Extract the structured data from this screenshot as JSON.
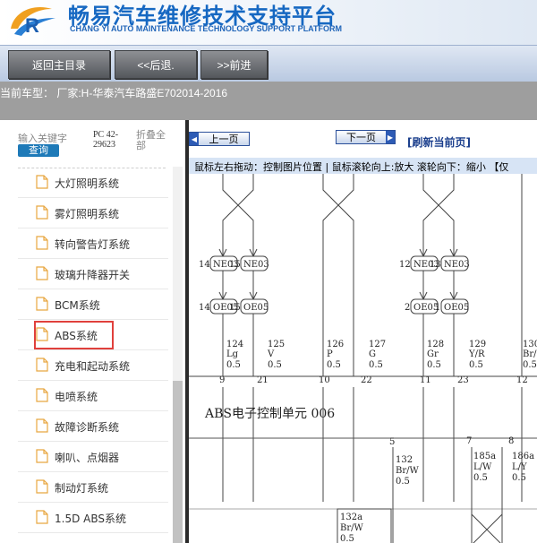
{
  "header": {
    "title_cn": "畅易汽车维修技术支持平台",
    "title_en": "CHANG YI AUTO MAINTENANCE TECHNOLOGY SUPPORT PLATFORM"
  },
  "nav": {
    "home_label": "返回主目录",
    "back_label": "<<后退.",
    "forward_label": ">>前进"
  },
  "model": {
    "text": "当前车型： 厂家:H-华泰汽车路盛E702014-2016"
  },
  "sidebar": {
    "search": {
      "placeholder": "输入关键字",
      "query_label": "查询",
      "pc_code": "PC 42-29623",
      "collapse_all": "折叠全部"
    },
    "items": [
      {
        "label": "大灯照明系统"
      },
      {
        "label": "雾灯照明系统"
      },
      {
        "label": "转向警告灯系统"
      },
      {
        "label": "玻璃升降器开关"
      },
      {
        "label": "BCM系统"
      },
      {
        "label": "ABS系统"
      },
      {
        "label": "充电和起动系统"
      },
      {
        "label": "电喷系统"
      },
      {
        "label": "故障诊断系统"
      },
      {
        "label": "喇叭、点烟器"
      },
      {
        "label": "制动灯系统"
      },
      {
        "label": "1.5D ABS系统"
      }
    ],
    "selected_index": 5
  },
  "viewer": {
    "prev_label": "上一页",
    "next_label": "下一页",
    "refresh_label": "[刷新当前页]",
    "hint": "鼠标左右拖动：控制图片位置 | 鼠标滚轮向上:放大  滚轮向下：缩小 【仅"
  },
  "diagram": {
    "connectors": [
      {
        "n1": "14",
        "c1": "NE03",
        "n2": "14",
        "c2": "OE05"
      },
      {
        "n1": "15",
        "c1": "NE03",
        "n2": "15",
        "c2": "OE05"
      },
      {
        "n1": "12",
        "c1": "NE03",
        "n2": "2",
        "c2": "OE05"
      },
      {
        "n1": "13",
        "c1": "NE03",
        "n2": "1",
        "c2": "OE05"
      }
    ],
    "wires": [
      {
        "num": "124",
        "color": "Lg",
        "size": "0.5",
        "pin": "9"
      },
      {
        "num": "125",
        "color": "V",
        "size": "0.5",
        "pin": "21"
      },
      {
        "num": "126",
        "color": "P",
        "size": "0.5",
        "pin": "10"
      },
      {
        "num": "127",
        "color": "G",
        "size": "0.5",
        "pin": "22"
      },
      {
        "num": "128",
        "color": "Gr",
        "size": "0.5",
        "pin": "11"
      },
      {
        "num": "129",
        "color": "Y/R",
        "size": "0.5",
        "pin": "23"
      },
      {
        "num": "130",
        "color": "Br/",
        "size": "0.5",
        "pin": "12"
      }
    ],
    "unit_label": "ABS电子控制单元 006",
    "lower_pins": [
      "5",
      "7",
      "8"
    ],
    "lower_wires": [
      {
        "num": "132",
        "color": "Br/W",
        "size": "0.5"
      },
      {
        "num": "185a",
        "color": "L/W",
        "size": "0.5"
      },
      {
        "num": "186a",
        "color": "L/Y",
        "size": "0.5"
      },
      {
        "num": "132a",
        "color": "Br/W",
        "size": "0.5"
      }
    ]
  },
  "colors": {
    "brand_blue": "#1668c2",
    "model_bar": "#9e9e9e",
    "hint_bar": "#d7e4f5",
    "selection_border": "#e0403c"
  }
}
